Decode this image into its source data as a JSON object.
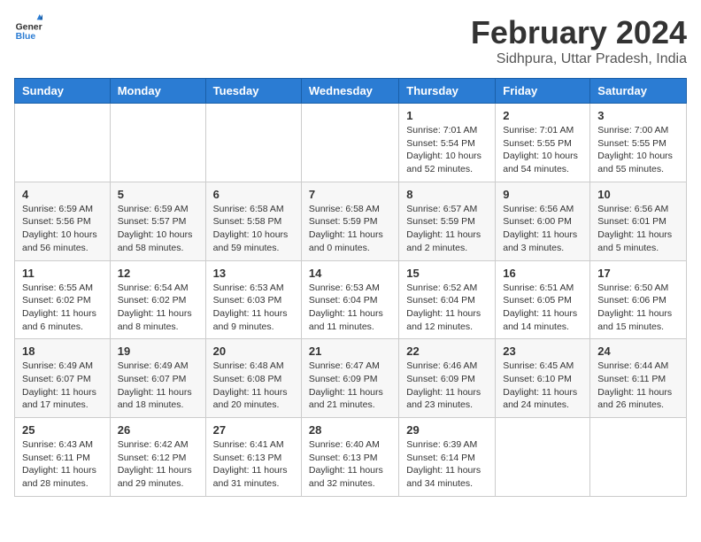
{
  "logo": {
    "line1": "General",
    "line2": "Blue"
  },
  "title": "February 2024",
  "subtitle": "Sidhpura, Uttar Pradesh, India",
  "weekdays": [
    "Sunday",
    "Monday",
    "Tuesday",
    "Wednesday",
    "Thursday",
    "Friday",
    "Saturday"
  ],
  "weeks": [
    [
      {
        "day": "",
        "info": ""
      },
      {
        "day": "",
        "info": ""
      },
      {
        "day": "",
        "info": ""
      },
      {
        "day": "",
        "info": ""
      },
      {
        "day": "1",
        "info": "Sunrise: 7:01 AM\nSunset: 5:54 PM\nDaylight: 10 hours\nand 52 minutes."
      },
      {
        "day": "2",
        "info": "Sunrise: 7:01 AM\nSunset: 5:55 PM\nDaylight: 10 hours\nand 54 minutes."
      },
      {
        "day": "3",
        "info": "Sunrise: 7:00 AM\nSunset: 5:55 PM\nDaylight: 10 hours\nand 55 minutes."
      }
    ],
    [
      {
        "day": "4",
        "info": "Sunrise: 6:59 AM\nSunset: 5:56 PM\nDaylight: 10 hours\nand 56 minutes."
      },
      {
        "day": "5",
        "info": "Sunrise: 6:59 AM\nSunset: 5:57 PM\nDaylight: 10 hours\nand 58 minutes."
      },
      {
        "day": "6",
        "info": "Sunrise: 6:58 AM\nSunset: 5:58 PM\nDaylight: 10 hours\nand 59 minutes."
      },
      {
        "day": "7",
        "info": "Sunrise: 6:58 AM\nSunset: 5:59 PM\nDaylight: 11 hours\nand 0 minutes."
      },
      {
        "day": "8",
        "info": "Sunrise: 6:57 AM\nSunset: 5:59 PM\nDaylight: 11 hours\nand 2 minutes."
      },
      {
        "day": "9",
        "info": "Sunrise: 6:56 AM\nSunset: 6:00 PM\nDaylight: 11 hours\nand 3 minutes."
      },
      {
        "day": "10",
        "info": "Sunrise: 6:56 AM\nSunset: 6:01 PM\nDaylight: 11 hours\nand 5 minutes."
      }
    ],
    [
      {
        "day": "11",
        "info": "Sunrise: 6:55 AM\nSunset: 6:02 PM\nDaylight: 11 hours\nand 6 minutes."
      },
      {
        "day": "12",
        "info": "Sunrise: 6:54 AM\nSunset: 6:02 PM\nDaylight: 11 hours\nand 8 minutes."
      },
      {
        "day": "13",
        "info": "Sunrise: 6:53 AM\nSunset: 6:03 PM\nDaylight: 11 hours\nand 9 minutes."
      },
      {
        "day": "14",
        "info": "Sunrise: 6:53 AM\nSunset: 6:04 PM\nDaylight: 11 hours\nand 11 minutes."
      },
      {
        "day": "15",
        "info": "Sunrise: 6:52 AM\nSunset: 6:04 PM\nDaylight: 11 hours\nand 12 minutes."
      },
      {
        "day": "16",
        "info": "Sunrise: 6:51 AM\nSunset: 6:05 PM\nDaylight: 11 hours\nand 14 minutes."
      },
      {
        "day": "17",
        "info": "Sunrise: 6:50 AM\nSunset: 6:06 PM\nDaylight: 11 hours\nand 15 minutes."
      }
    ],
    [
      {
        "day": "18",
        "info": "Sunrise: 6:49 AM\nSunset: 6:07 PM\nDaylight: 11 hours\nand 17 minutes."
      },
      {
        "day": "19",
        "info": "Sunrise: 6:49 AM\nSunset: 6:07 PM\nDaylight: 11 hours\nand 18 minutes."
      },
      {
        "day": "20",
        "info": "Sunrise: 6:48 AM\nSunset: 6:08 PM\nDaylight: 11 hours\nand 20 minutes."
      },
      {
        "day": "21",
        "info": "Sunrise: 6:47 AM\nSunset: 6:09 PM\nDaylight: 11 hours\nand 21 minutes."
      },
      {
        "day": "22",
        "info": "Sunrise: 6:46 AM\nSunset: 6:09 PM\nDaylight: 11 hours\nand 23 minutes."
      },
      {
        "day": "23",
        "info": "Sunrise: 6:45 AM\nSunset: 6:10 PM\nDaylight: 11 hours\nand 24 minutes."
      },
      {
        "day": "24",
        "info": "Sunrise: 6:44 AM\nSunset: 6:11 PM\nDaylight: 11 hours\nand 26 minutes."
      }
    ],
    [
      {
        "day": "25",
        "info": "Sunrise: 6:43 AM\nSunset: 6:11 PM\nDaylight: 11 hours\nand 28 minutes."
      },
      {
        "day": "26",
        "info": "Sunrise: 6:42 AM\nSunset: 6:12 PM\nDaylight: 11 hours\nand 29 minutes."
      },
      {
        "day": "27",
        "info": "Sunrise: 6:41 AM\nSunset: 6:13 PM\nDaylight: 11 hours\nand 31 minutes."
      },
      {
        "day": "28",
        "info": "Sunrise: 6:40 AM\nSunset: 6:13 PM\nDaylight: 11 hours\nand 32 minutes."
      },
      {
        "day": "29",
        "info": "Sunrise: 6:39 AM\nSunset: 6:14 PM\nDaylight: 11 hours\nand 34 minutes."
      },
      {
        "day": "",
        "info": ""
      },
      {
        "day": "",
        "info": ""
      }
    ]
  ]
}
